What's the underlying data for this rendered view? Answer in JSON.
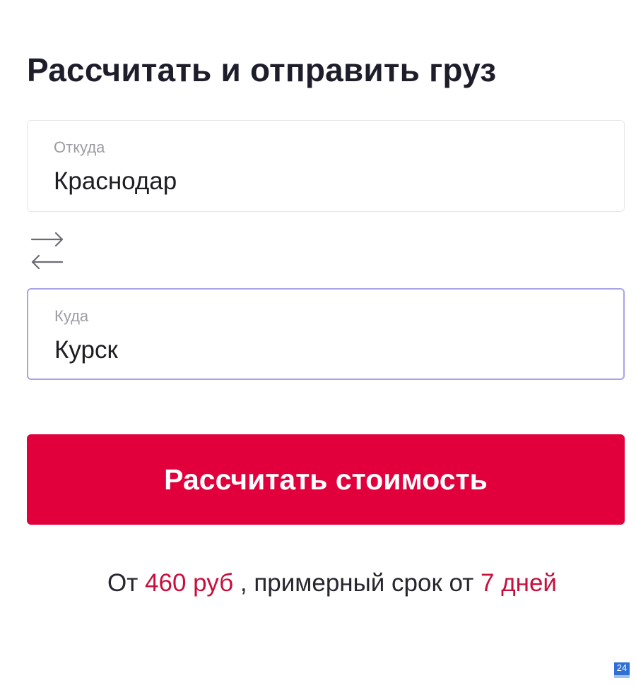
{
  "title": "Рассчитать и отправить груз",
  "from": {
    "label": "Откуда",
    "value": "Краснодар"
  },
  "to": {
    "label": "Куда",
    "value": "Курск"
  },
  "swap_icon": "swap-arrows-icon",
  "calculate_button": "Рассчитать стоимость",
  "result": {
    "prefix": "От",
    "price": "460 руб",
    "middle": ", примерный срок от",
    "duration": "7 дней"
  },
  "badge": "24",
  "colors": {
    "accent": "#e2003c",
    "accent_text": "#c8103e",
    "active_border": "#a9a3e6",
    "badge": "#2f6fd6"
  }
}
